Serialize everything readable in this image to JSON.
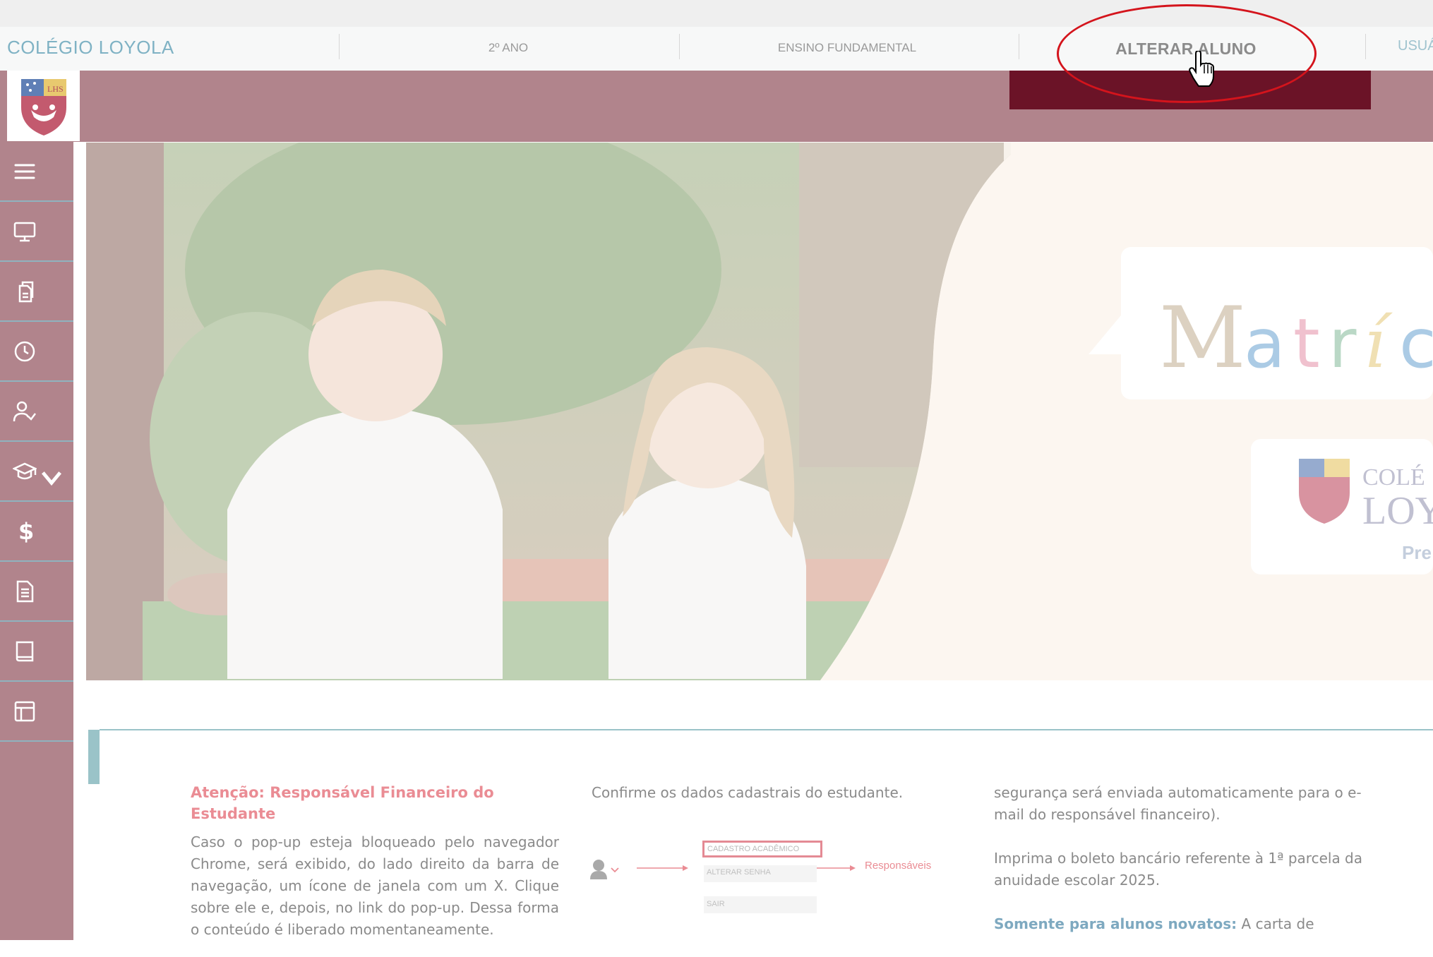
{
  "topbar": {
    "brand": "COLÉGIO LOYOLA",
    "grade": "2º ANO",
    "level": "ENSINO FUNDAMENTAL",
    "change_student": "ALTERAR ALUNO",
    "user": "USUÁ"
  },
  "sidebar": {
    "items": [
      {
        "icon": "menu-icon"
      },
      {
        "icon": "monitor-icon"
      },
      {
        "icon": "documents-icon"
      },
      {
        "icon": "clock-icon"
      },
      {
        "icon": "user-check-icon"
      },
      {
        "icon": "graduation-cap-icon"
      },
      {
        "icon": "dollar-icon",
        "glyph": "$"
      },
      {
        "icon": "document-icon"
      },
      {
        "icon": "book-icon"
      },
      {
        "icon": "layout-icon"
      }
    ]
  },
  "hero": {
    "title_partial": "Matríc",
    "school_partial_1": "COLÉ",
    "school_partial_2": "LOY",
    "sub_partial": "Pre",
    "logo_caption": "LHS"
  },
  "content": {
    "col1": {
      "heading": "Atenção: Responsável Financeiro do Estudante",
      "text": "Caso o pop-up esteja bloqueado pelo navegador Chrome, será exibido, do lado direito da barra de navegação, um ícone de janela com um X. Clique sobre ele e, depois, no link do pop-up. Dessa forma o conteúdo é liberado momentaneamente."
    },
    "col2": {
      "text": "Confirme os dados cadastrais do estudante.",
      "menu_cadastro": "CADASTRO ACADÊMICO",
      "menu_senha": "ALTERAR SENHA",
      "menu_sair": "SAIR",
      "responsaveis": "Responsáveis"
    },
    "col3": {
      "p1": "segurança será enviada automaticamente para o e-mail do responsável financeiro).",
      "p2": "Imprima o boleto bancário referente à 1ª parcela da anuidade escolar 2025.",
      "p3_bold": "Somente para alunos novatos:",
      "p3_rest": " A carta de"
    }
  },
  "colors": {
    "header": "#b1848c",
    "dark_block": "#6b1327",
    "accent_teal": "#9ac3c8",
    "annotation": "#d4141c",
    "heading_pink": "#ea8c94"
  }
}
